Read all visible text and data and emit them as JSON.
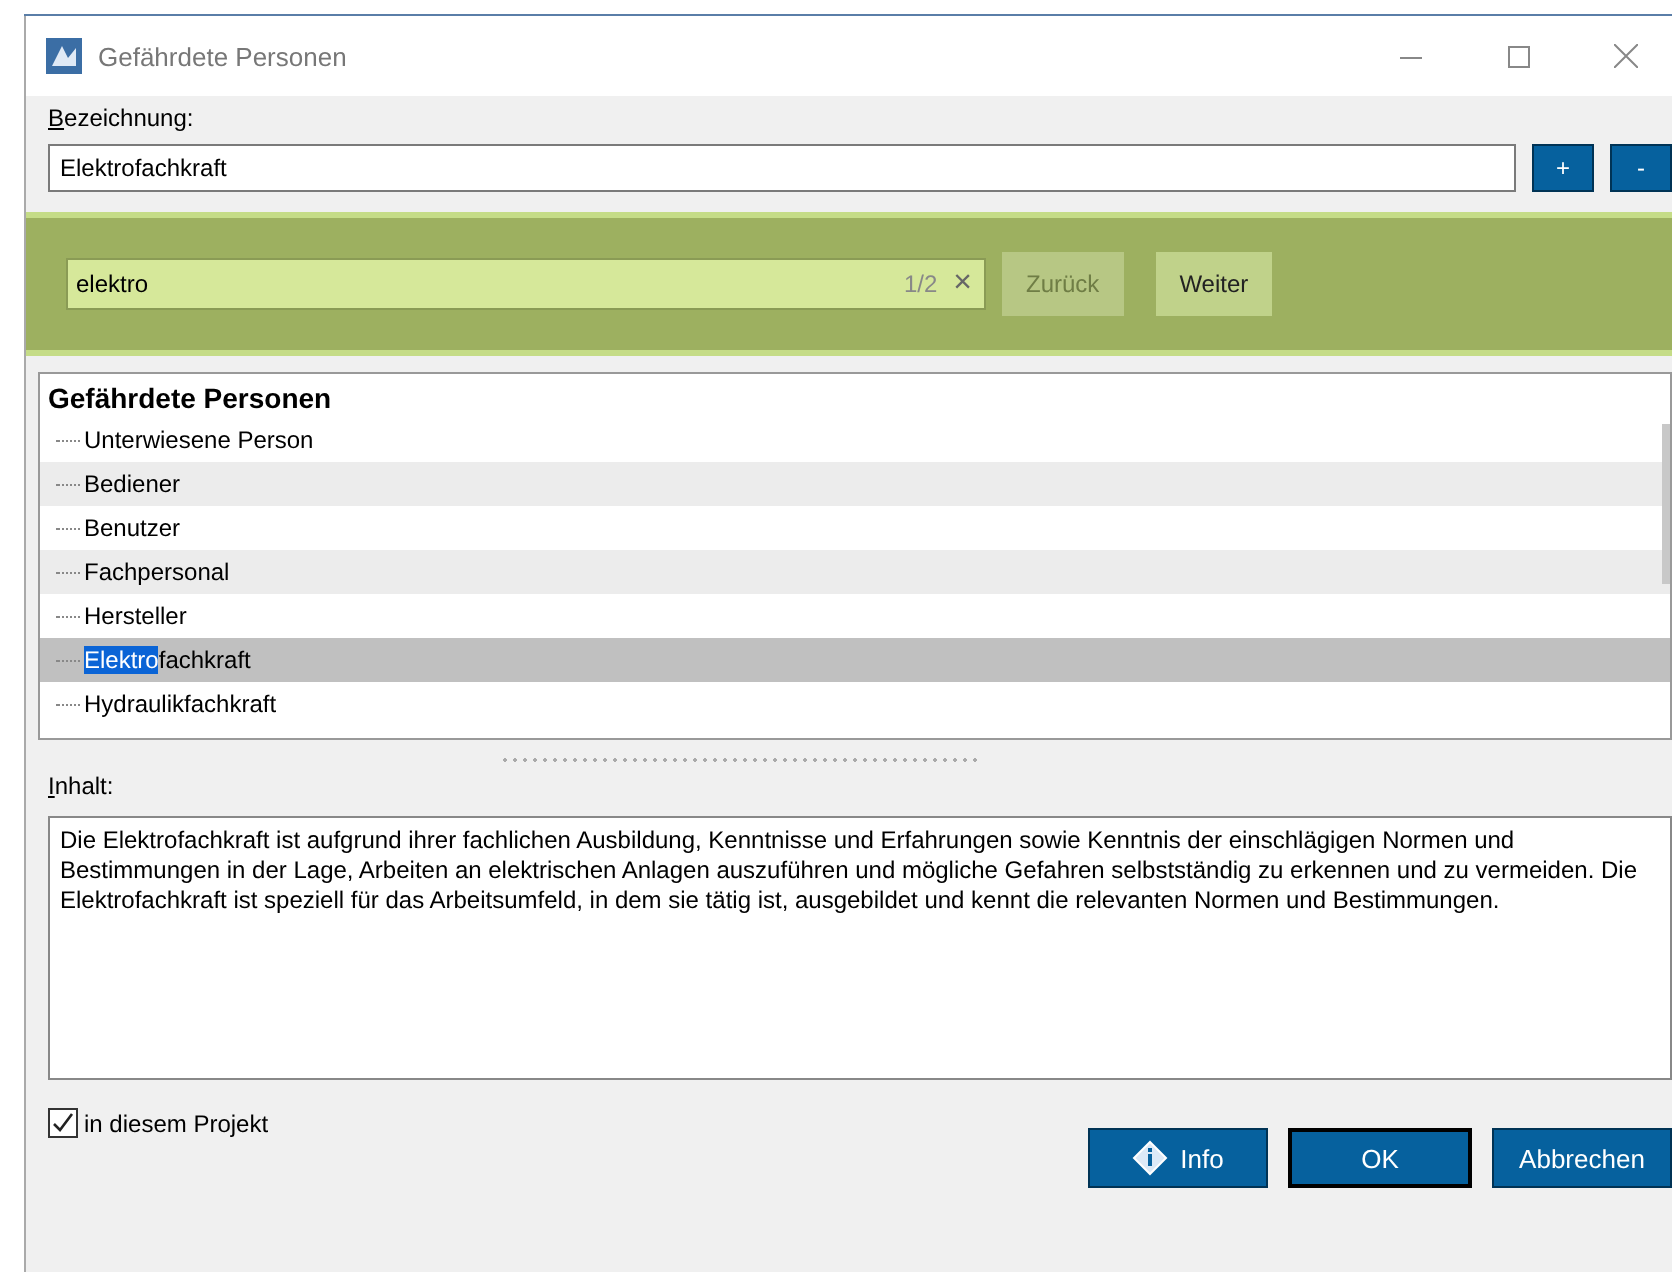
{
  "window": {
    "title": "Gefährdete Personen"
  },
  "name_label": "Bezeichnung:",
  "name_value": "Elektrofachkraft",
  "add_button": "+",
  "remove_button": "-",
  "search": {
    "value": "elektro",
    "count": "1/2",
    "clear": "×",
    "back": {
      "label": "Zurück",
      "disabled": true
    },
    "next": {
      "label": "Weiter",
      "disabled": false
    }
  },
  "tree": {
    "title": "Gefährdete Personen",
    "items": [
      {
        "text": "Unterwiesene Person",
        "selected": false
      },
      {
        "text": "Bediener",
        "selected": false
      },
      {
        "text": "Benutzer",
        "selected": false
      },
      {
        "text": "Fachpersonal",
        "selected": false
      },
      {
        "text": "Hersteller",
        "selected": false
      },
      {
        "match": "Elektro",
        "text": "fachkraft",
        "selected": true
      },
      {
        "text": "Hydraulikfachkraft",
        "selected": false
      }
    ]
  },
  "content_label": "Inhalt:",
  "content": "Die Elektrofachkraft ist aufgrund ihrer fachlichen Ausbildung, Kenntnisse und Erfahrungen sowie Kenntnis der einschlägigen Normen und Bestimmungen in der Lage, Arbeiten an elektrischen Anlagen auszuführen und mögliche Gefahren selbstständig zu erkennen und zu vermeiden.  Die Elektrofachkraft ist speziell für das Arbeitsumfeld, in dem sie tätig ist, ausgebildet und kennt die relevanten Normen und Bestimmungen.",
  "project_checkbox": {
    "label": "in diesem Projekt",
    "checked": true
  },
  "buttons": {
    "info": "Info",
    "ok": "OK",
    "cancel": "Abbrechen"
  }
}
